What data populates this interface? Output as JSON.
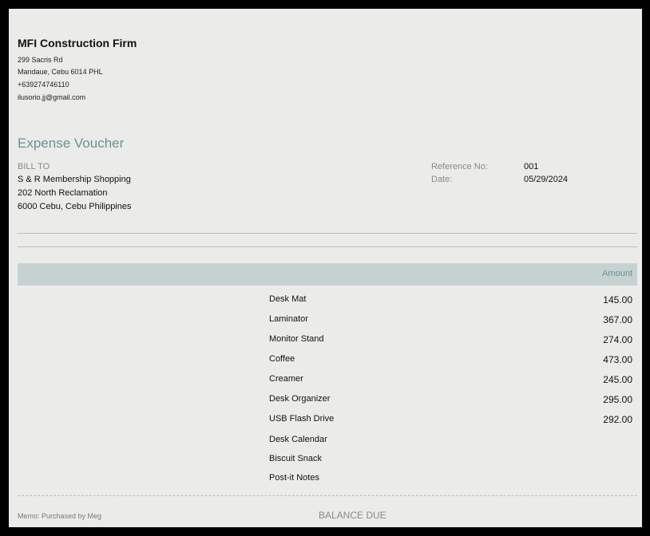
{
  "company": {
    "name": "MFI Construction Firm",
    "address_line1": "299 Sacris Rd",
    "address_line2": "Mandaue, Cebu  6014 PHL",
    "phone": "+639274746110",
    "email": "ilusorio.jj@gmail.com"
  },
  "document": {
    "title": "Expense Voucher"
  },
  "bill_to": {
    "label": "BILL TO",
    "name": "S & R Membership Shopping",
    "address_line1": "202 North Reclamation",
    "address_line2": "6000 Cebu, Cebu Philippines"
  },
  "meta": {
    "reference_label": "Reference No:",
    "reference_value": "001",
    "date_label": "Date:",
    "date_value": "05/29/2024"
  },
  "table": {
    "amount_header": "Amount",
    "items": [
      {
        "description": "Desk Mat",
        "amount": "145.00"
      },
      {
        "description": "Laminator",
        "amount": "367.00"
      },
      {
        "description": "Monitor Stand",
        "amount": "274.00"
      },
      {
        "description": "Coffee",
        "amount": "473.00"
      },
      {
        "description": "Creamer",
        "amount": "245.00"
      },
      {
        "description": "Desk Organizer",
        "amount": "295.00"
      },
      {
        "description": "USB Flash Drive",
        "amount": "292.00"
      },
      {
        "description": "Desk Calendar",
        "amount": ""
      },
      {
        "description": "Biscuit Snack",
        "amount": ""
      },
      {
        "description": "Post-it Notes",
        "amount": ""
      }
    ]
  },
  "footer": {
    "memo": "Memo: Purchased by Meg",
    "balance_due_label": "BALANCE DUE"
  }
}
